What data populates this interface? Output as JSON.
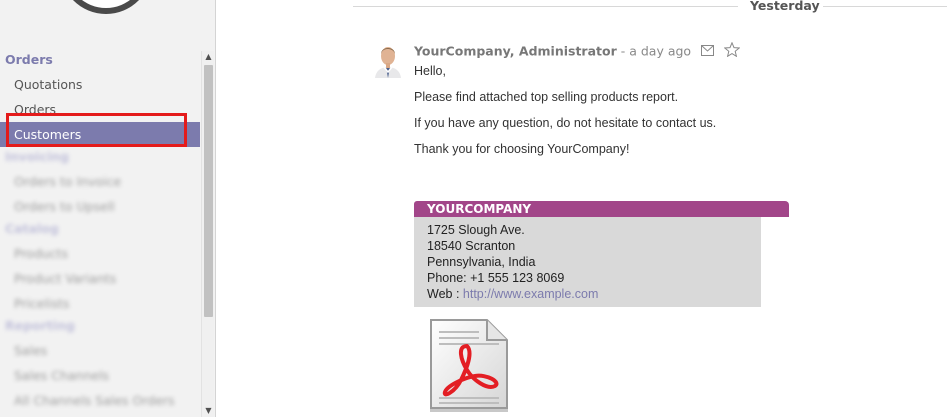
{
  "sidebar": {
    "sections": [
      {
        "label": "Orders",
        "items": [
          "Quotations",
          "Orders",
          "Customers"
        ],
        "active": "Customers"
      },
      {
        "label": "Invoicing",
        "items": [
          "Orders to Invoice",
          "Orders to Upsell"
        ]
      },
      {
        "label": "Catalog",
        "items": [
          "Products",
          "Product Variants",
          "Pricelists"
        ]
      },
      {
        "label": "Reporting",
        "items": [
          "Sales",
          "Sales Channels",
          "All Channels Sales Orders"
        ]
      }
    ]
  },
  "chatter": {
    "date_separator": "Yesterday",
    "message": {
      "author": "YourCompany, Administrator",
      "time": "- a day ago",
      "greeting": "Hello,",
      "lines": [
        "Please find attached top selling products report.",
        "If you have any question, do not hesitate to contact us.",
        "Thank you for choosing YourCompany!"
      ],
      "signature": {
        "company": "YOURCOMPANY",
        "address_1": "1725 Slough Ave.",
        "address_2": "18540 Scranton",
        "address_3": "Pennsylvania, India",
        "phone": "Phone:  +1 555 123 8069",
        "web_label": "Web : ",
        "web_url": "http://www.example.com"
      },
      "attachment_icon": "pdf-file-icon"
    }
  },
  "colors": {
    "accent": "#7c7bad",
    "signature_header": "#a24689",
    "highlight": "#e41b1b"
  }
}
